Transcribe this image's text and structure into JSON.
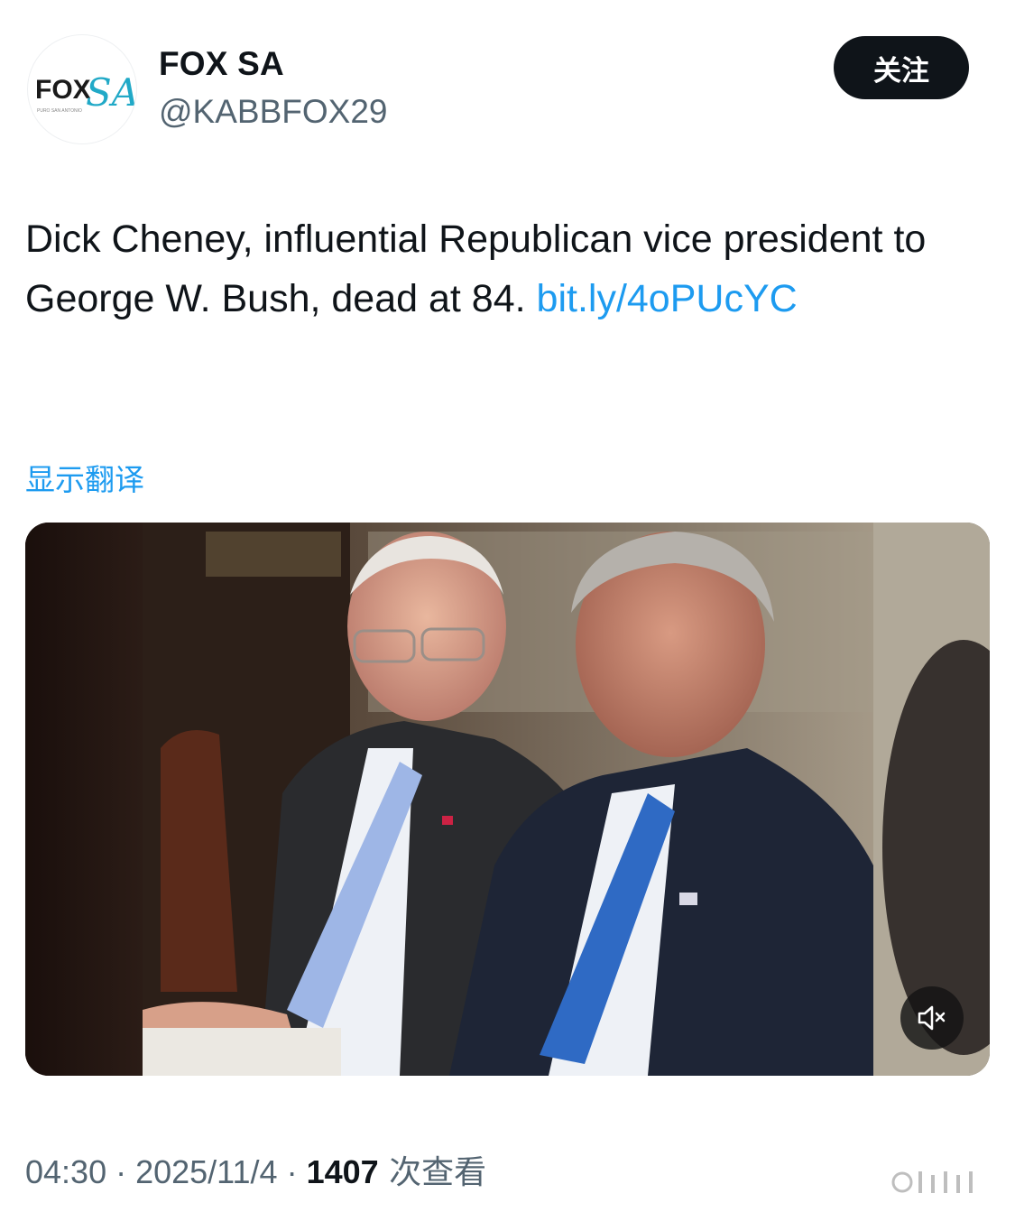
{
  "author": {
    "display_name": "FOX SA",
    "handle": "@KABBFOX29",
    "avatar_logo": {
      "word": "FOX",
      "script": "SA",
      "tagline": "PURO SAN ANTONIO"
    }
  },
  "follow_button": {
    "label": "关注"
  },
  "tweet": {
    "text": "Dick Cheney, influential Republican vice president to George W. Bush, dead at 84. ",
    "link": "bit.ly/4oPUcYC"
  },
  "translate_label": "显示翻译",
  "media": {
    "type": "video",
    "muted_icon": "speaker-muted-icon"
  },
  "meta": {
    "time": "04:30",
    "sep1": " · ",
    "date": "2025/11/4",
    "sep2": " · ",
    "views": "1407",
    "views_label": " 次查看"
  },
  "colors": {
    "link": "#1d9bf0",
    "text": "#0f1419",
    "secondary": "#536471",
    "button_bg": "#0f1419",
    "logo_accent": "#21a9c7"
  }
}
